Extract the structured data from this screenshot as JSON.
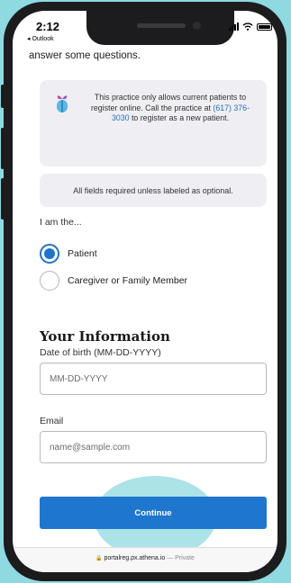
{
  "status_bar": {
    "time": "2:12",
    "back_app": "◂ Outlook"
  },
  "page": {
    "intro_text": "answer some questions.",
    "notice": {
      "text_before": "This practice only allows current patients to register online. Call the practice at",
      "phone": "(617) 376-3030",
      "text_after": "to register as a new patient."
    },
    "required_note": "All fields required unless labeled as optional.",
    "role_label": "I am the...",
    "role_options": [
      {
        "label": "Patient",
        "selected": true
      },
      {
        "label": "Caregiver or Family Member",
        "selected": false
      }
    ],
    "section_title": "Your Information",
    "dob": {
      "label": "Date of birth (MM-DD-YYYY)",
      "placeholder": "MM-DD-YYYY",
      "value": ""
    },
    "email": {
      "label": "Email",
      "placeholder": "name@sample.com",
      "value": ""
    },
    "continue_label": "Continue"
  },
  "browser": {
    "lock": "🔒",
    "url": "portalreg.px.athena.io",
    "separator": "—",
    "mode": "Private"
  },
  "colors": {
    "accent": "#1f76cf",
    "panel": "#efeff3",
    "background": "#8fd9e0"
  }
}
